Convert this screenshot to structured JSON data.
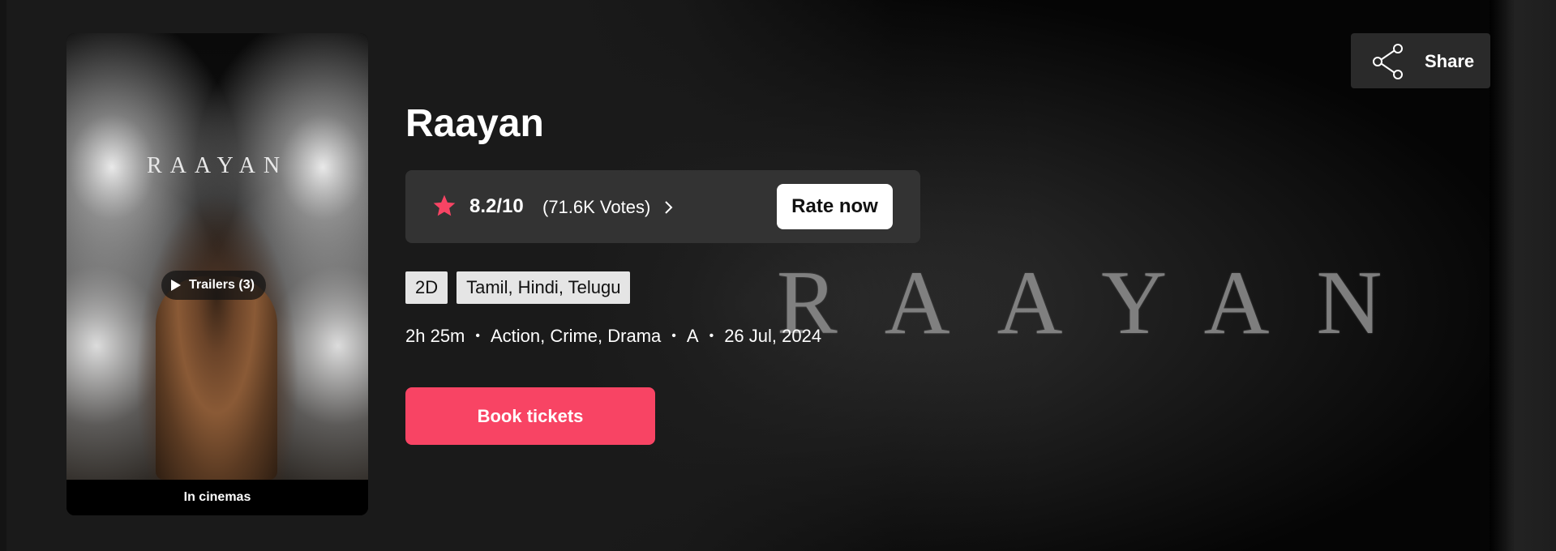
{
  "colors": {
    "accent": "#f84464",
    "rating_box_bg": "#333333",
    "star": "#f84464",
    "background": "#1a1a1a"
  },
  "backdrop": {
    "title_text": "RAAYAN"
  },
  "poster": {
    "title_text": "RAAYAN",
    "trailer_label": "Trailers (3)",
    "footer": "In cinemas"
  },
  "movie": {
    "title": "Raayan",
    "rating": "8.2/10",
    "votes": "(71.6K Votes)",
    "rate_now_label": "Rate now",
    "tags": [
      "2D",
      "Tamil, Hindi, Telugu"
    ],
    "meta": {
      "duration": "2h 25m",
      "genres": "Action, Crime, Drama",
      "certificate": "A",
      "release_date": "26 Jul, 2024"
    },
    "book_label": "Book tickets"
  },
  "share": {
    "label": "Share",
    "icon": "share-icon"
  }
}
